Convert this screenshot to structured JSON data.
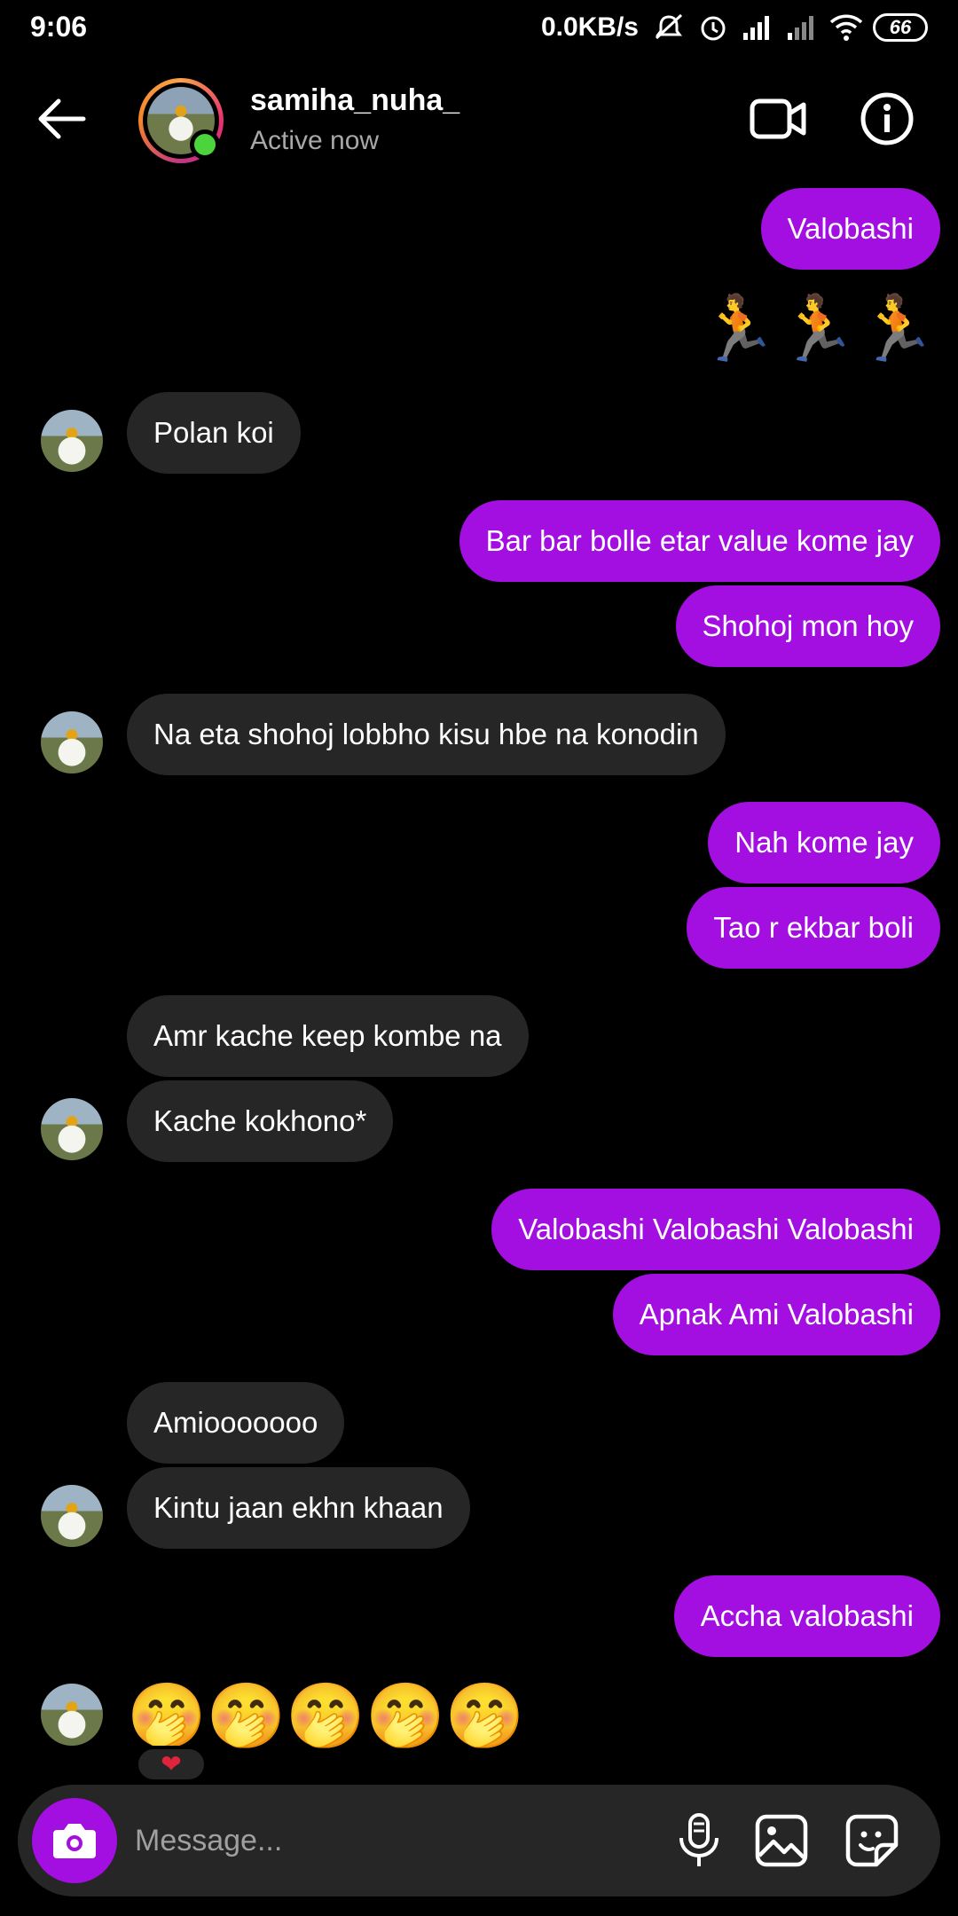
{
  "status_bar": {
    "time": "9:06",
    "net_speed": "0.0KB/s",
    "battery": "66",
    "icons": [
      "mute-icon",
      "alarm-icon",
      "signal-icon",
      "signal-weak-icon",
      "wifi-icon",
      "battery-icon"
    ]
  },
  "header": {
    "username": "samiha_nuha_",
    "status": "Active now",
    "icons": [
      "back-arrow-icon",
      "video-call-icon",
      "info-icon"
    ]
  },
  "messages": [
    {
      "side": "sent",
      "text": "Valobashi"
    },
    {
      "side": "sent",
      "text": "🏃🏃🏃"
    },
    {
      "side": "recv",
      "text": "Polan koi"
    },
    {
      "side": "sent",
      "text": "Bar bar bolle etar value kome jay"
    },
    {
      "side": "sent",
      "text": "Shohoj mon hoy"
    },
    {
      "side": "recv",
      "text": "Na eta shohoj lobbho kisu hbe na konodin"
    },
    {
      "side": "sent",
      "text": "Nah kome jay"
    },
    {
      "side": "sent",
      "text": "Tao r ekbar boli"
    },
    {
      "side": "recv",
      "text": "Amr kache keep kombe na"
    },
    {
      "side": "recv",
      "text": "Kache kokhono*"
    },
    {
      "side": "sent",
      "text": "Valobashi Valobashi Valobashi"
    },
    {
      "side": "sent",
      "text": "Apnak Ami Valobashi"
    },
    {
      "side": "recv",
      "text": "Amiooooooo"
    },
    {
      "side": "recv",
      "text": "Kintu jaan ekhn khaan"
    },
    {
      "side": "sent",
      "text": "Accha valobashi"
    },
    {
      "side": "recv",
      "text": "🤭🤭🤭🤭🤭"
    }
  ],
  "reaction": "❤",
  "composer": {
    "placeholder": "Message...",
    "icons": [
      "camera-icon",
      "microphone-icon",
      "gallery-icon",
      "sticker-icon"
    ]
  },
  "colors": {
    "sent_bubble": "#a20fe0",
    "received_bubble": "#262626",
    "background": "#000000",
    "online": "#4bd43b"
  }
}
